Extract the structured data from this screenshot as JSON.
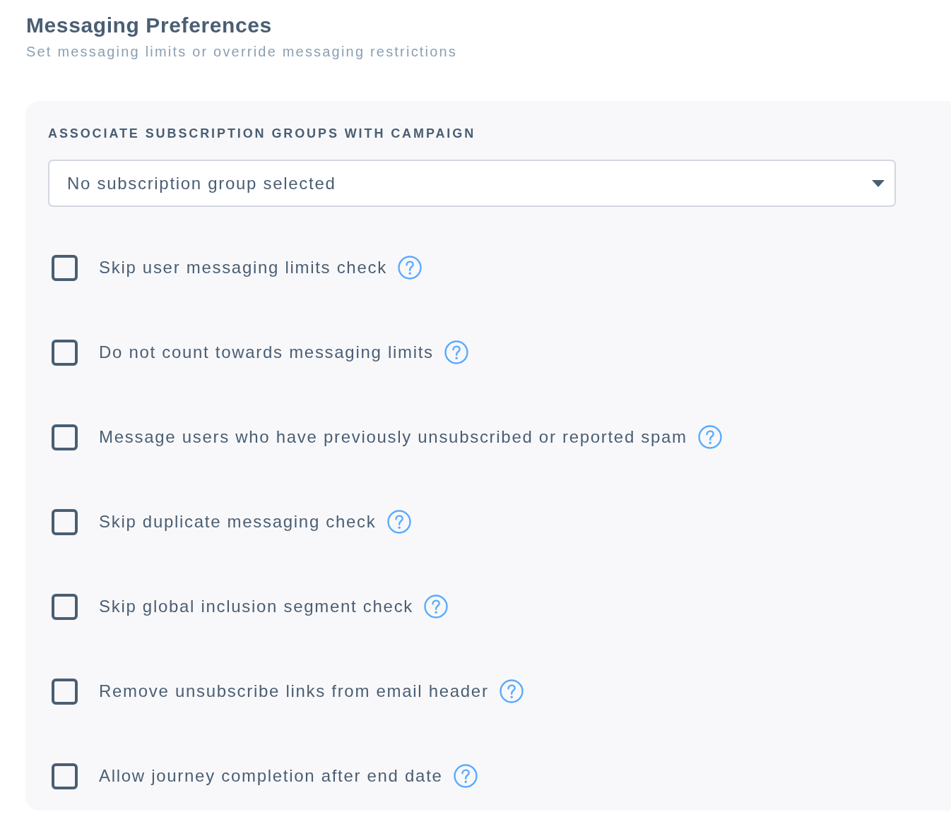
{
  "header": {
    "title": "Messaging Preferences",
    "subtitle": "Set messaging limits or override messaging restrictions"
  },
  "subscription_groups": {
    "label": "ASSOCIATE SUBSCRIPTION GROUPS WITH CAMPAIGN",
    "dropdown": {
      "value": "No subscription group selected"
    }
  },
  "options": [
    {
      "label": "Skip user messaging limits check",
      "checked": false
    },
    {
      "label": "Do not count towards messaging limits",
      "checked": false
    },
    {
      "label": "Message users who have previously unsubscribed or reported spam",
      "checked": false
    },
    {
      "label": "Skip duplicate messaging check",
      "checked": false
    },
    {
      "label": "Skip global inclusion segment check",
      "checked": false
    },
    {
      "label": "Remove unsubscribe links from email header",
      "checked": false
    },
    {
      "label": "Allow journey completion after end date",
      "checked": false
    }
  ]
}
